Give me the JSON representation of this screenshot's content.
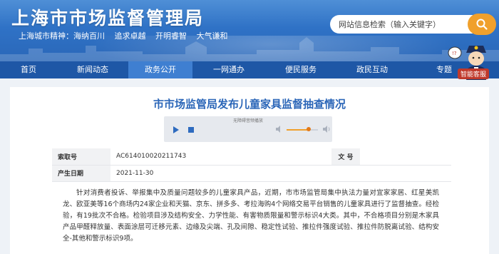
{
  "site": {
    "title": "上海市市场监督管理局",
    "spirit": [
      "上海城市精神：海纳百川",
      "追求卓越",
      "开明睿智",
      "大气谦和"
    ]
  },
  "search": {
    "placeholder": "网站信息检索（输入关键字）"
  },
  "assistant": {
    "label": "智能客服"
  },
  "nav": {
    "items": [
      {
        "label": "首页"
      },
      {
        "label": "新闻动态"
      },
      {
        "label": "政务公开",
        "active": true
      },
      {
        "label": "一网通办"
      },
      {
        "label": "便民服务"
      },
      {
        "label": "政民互动"
      },
      {
        "label": "专题"
      }
    ]
  },
  "article": {
    "title": "市市场监管局发布儿童家具监督抽查情况",
    "player": {
      "label": "无障碍音频播放",
      "volume": 0.7
    },
    "info": {
      "index_label": "索取号",
      "index_value": "AC614010020211743",
      "doc_label": "文 号",
      "doc_value": "",
      "date_label": "产生日期",
      "date_value": "2021-11-30"
    },
    "body": "针对消费者投诉、举报集中及质量问题较多的儿童家具产品，近期，市市场监管局集中执法力量对宜家家居、红星美凯龙、欧亚美等16个商场内24家企业和天猫、京东、拼多多、考拉海购4个网络交易平台销售的儿童家具进行了监督抽查。经检验，有19批次不合格。检验项目涉及结构安全、力学性能、有害物质限量和警示标识4大类。其中，不合格项目分别是木家具产品甲醛释放量、表面涂层可迁移元素、边缘及尖端、孔及间隙、稳定性试验、推拉件强度试验、推拉件防脱离试验、结构安全-其他和警示标识9项。"
  },
  "colors": {
    "header": "#2f72c6",
    "nav": "#1e57a6",
    "nav_active": "#3f7fd1",
    "title": "#2b66b8",
    "search_button": "#f0a02c"
  }
}
